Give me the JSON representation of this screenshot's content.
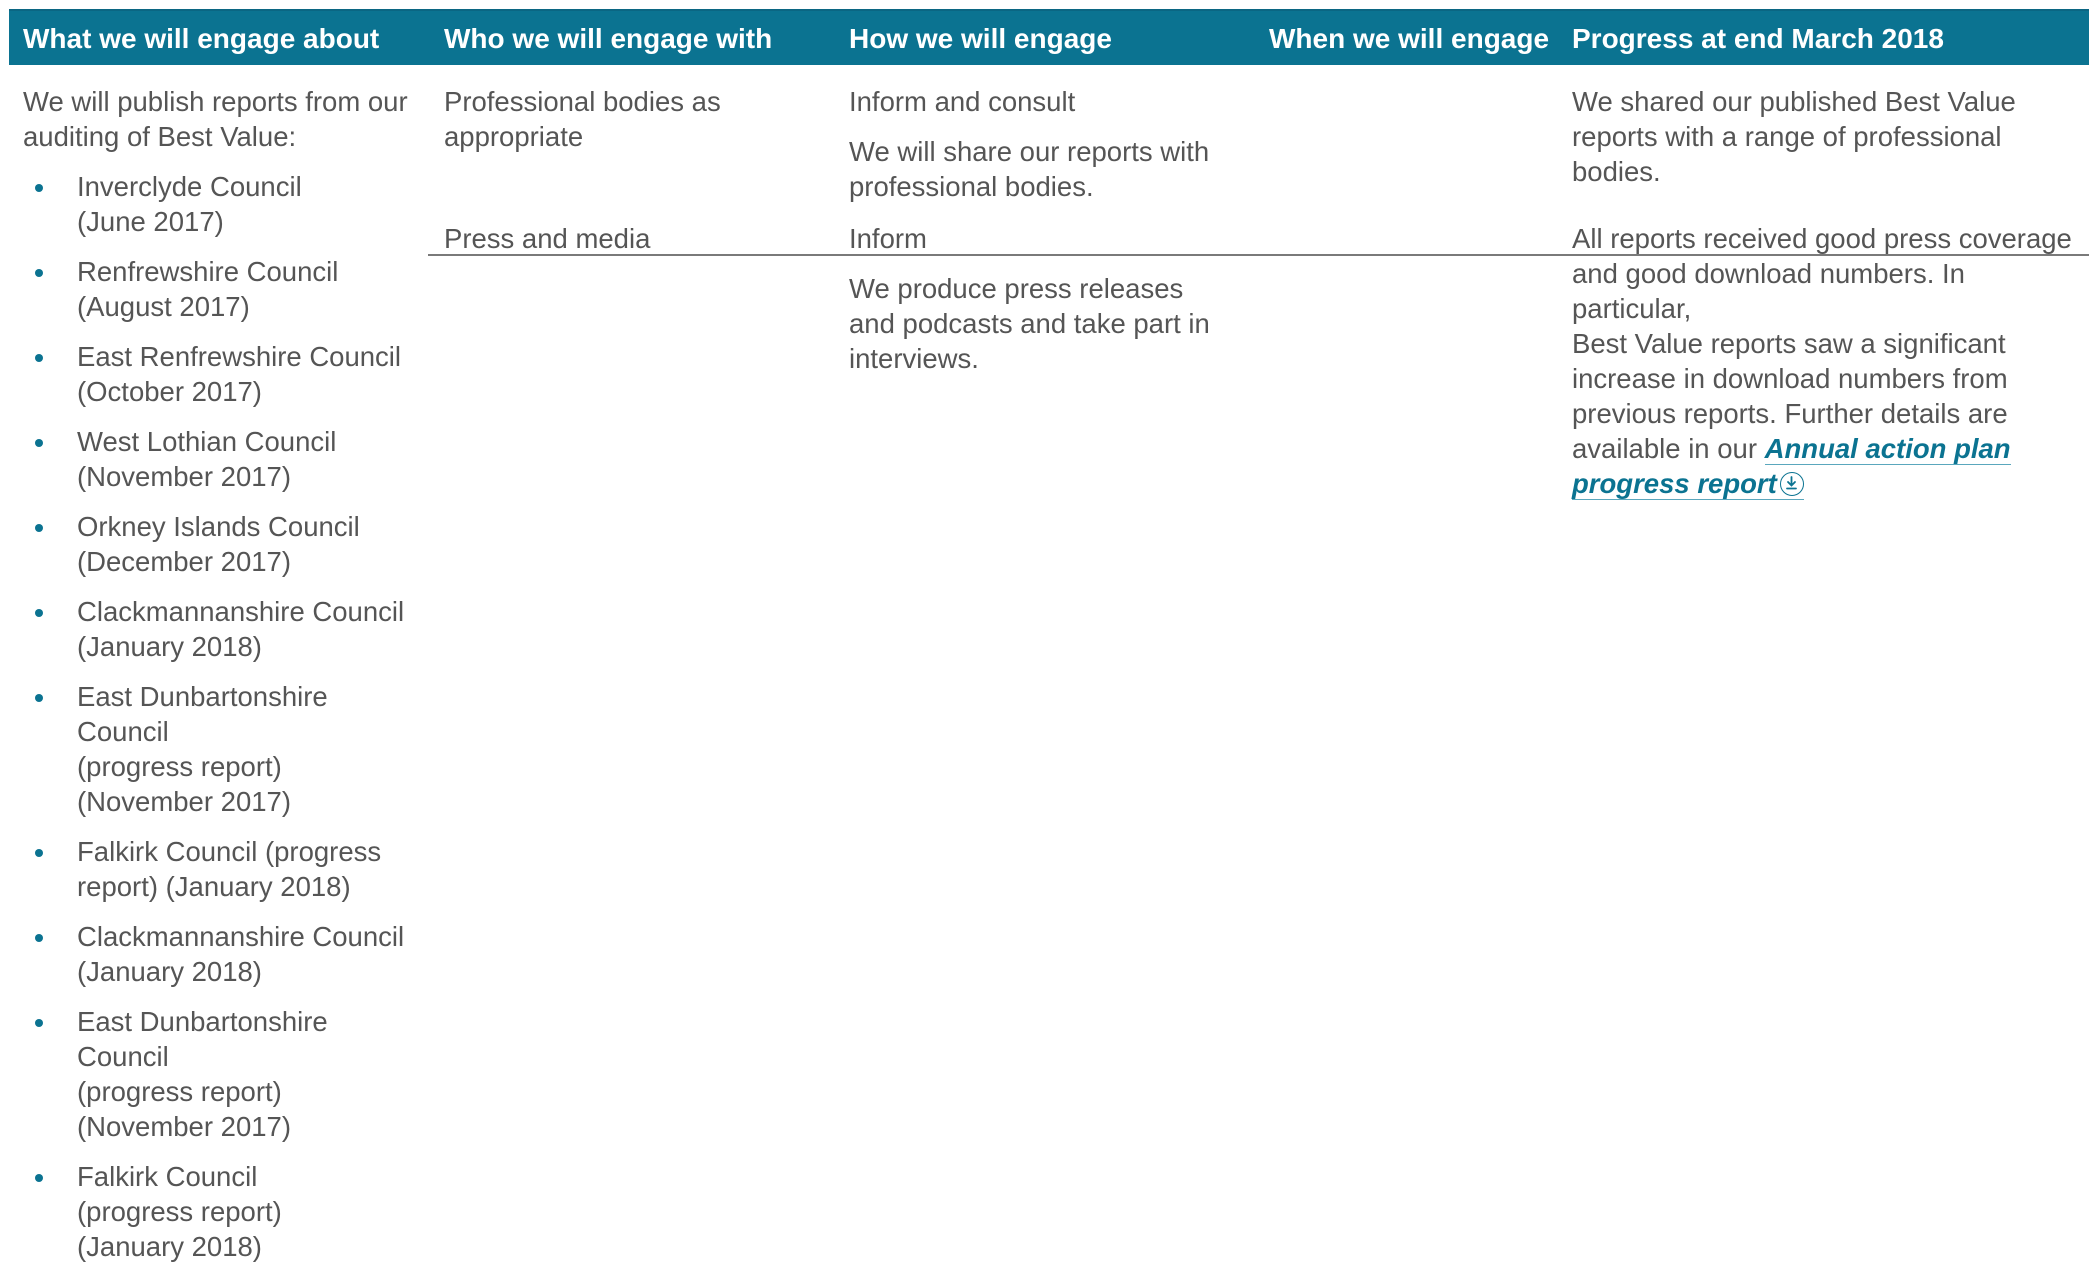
{
  "header": {
    "col1": "What we will engage about",
    "col2": "Who we will engage with",
    "col3": "How we will engage",
    "col4": "When we will engage",
    "col5": "Progress at end March 2018"
  },
  "column1": {
    "intro": "We will publish reports from our auditing of Best Value:",
    "items": [
      {
        "line1": "Inverclyde Council",
        "line2": "(June 2017)"
      },
      {
        "line1": "Renfrewshire Council",
        "line2": "(August 2017)"
      },
      {
        "line1": "East Renfrewshire Council",
        "line2": "(October 2017)"
      },
      {
        "line1": "West Lothian Council",
        "line2": "(November 2017)"
      },
      {
        "line1": "Orkney Islands Council",
        "line2": "(December 2017)"
      },
      {
        "line1": "Clackmannanshire Council",
        "line2": "(January 2018)"
      },
      {
        "line1": "East Dunbartonshire Council",
        "line2": "(progress report)",
        "line3": "(November 2017)"
      },
      {
        "line1": "Falkirk Council (progress",
        "line2": "report) (January 2018)"
      },
      {
        "line1": "Clackmannanshire Council",
        "line2": "(January 2018)"
      },
      {
        "line1": "East Dunbartonshire Council",
        "line2": "(progress report)",
        "line3": "(November 2017)"
      },
      {
        "line1": "Falkirk Council",
        "line2": "(progress report)",
        "line3": "(January 2018)"
      }
    ]
  },
  "row1": {
    "who_line1": "Professional bodies as",
    "who_line2": "appropriate",
    "how_title": "Inform and consult",
    "how_line1": "We will share our reports with",
    "how_line2": "professional bodies.",
    "progress_line1": "We shared our published Best Value",
    "progress_line2": "reports with a range of professional bodies."
  },
  "row2": {
    "who": "Press and media",
    "how_title": "Inform",
    "how_line1": "We produce press releases",
    "how_line2": "and podcasts and take part in",
    "how_line3": "interviews.",
    "progress_line1": "All reports received good press coverage",
    "progress_line2": "and good download numbers. In particular,",
    "progress_line3": "Best Value reports saw a significant",
    "progress_line4": "increase in download numbers from",
    "progress_line5": "previous reports. Further details are",
    "progress_line6": "available in our",
    "link_line1": "Annual action plan",
    "link_line2": "progress report"
  },
  "colors": {
    "header_bg": "#0b7391",
    "accent": "#0b7391",
    "text": "#555555"
  }
}
